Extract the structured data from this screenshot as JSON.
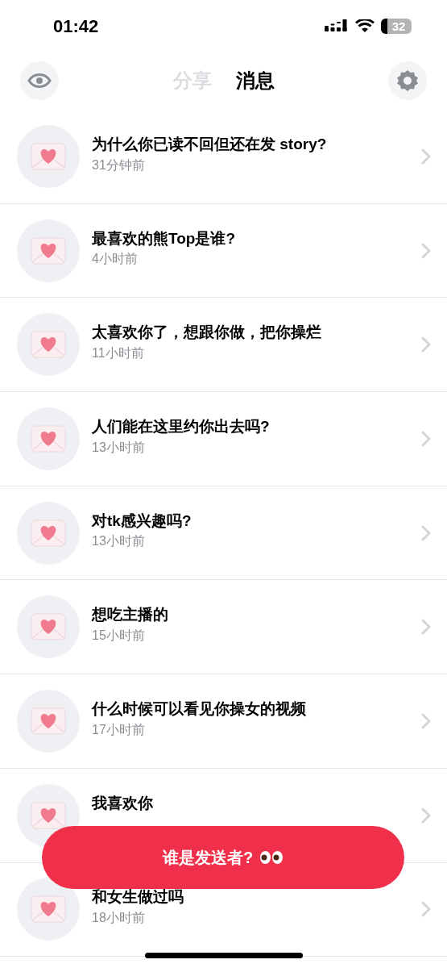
{
  "status_bar": {
    "time": "01:42",
    "battery": "32"
  },
  "header": {
    "tabs": [
      {
        "label": "分享",
        "selected": false
      },
      {
        "label": "消息",
        "selected": true
      }
    ]
  },
  "messages": [
    {
      "title": "为什么你已读不回但还在发 story?",
      "time": "31分钟前"
    },
    {
      "title": "最喜欢的熊Top是谁?",
      "time": "4小时前"
    },
    {
      "title": "太喜欢你了，想跟你做，把你操烂",
      "time": "11小时前"
    },
    {
      "title": "人们能在这里约你出去吗?",
      "time": "13小时前"
    },
    {
      "title": "对tk感兴趣吗?",
      "time": "13小时前"
    },
    {
      "title": "想吃主播的",
      "time": "15小时前"
    },
    {
      "title": "什么时候可以看见你操女的视频",
      "time": "17小时前"
    },
    {
      "title": "我喜欢你"
    },
    {
      "title": "和女生做过吗",
      "time": "18小时前"
    }
  ],
  "action_button": {
    "label": "谁是发送者?"
  }
}
